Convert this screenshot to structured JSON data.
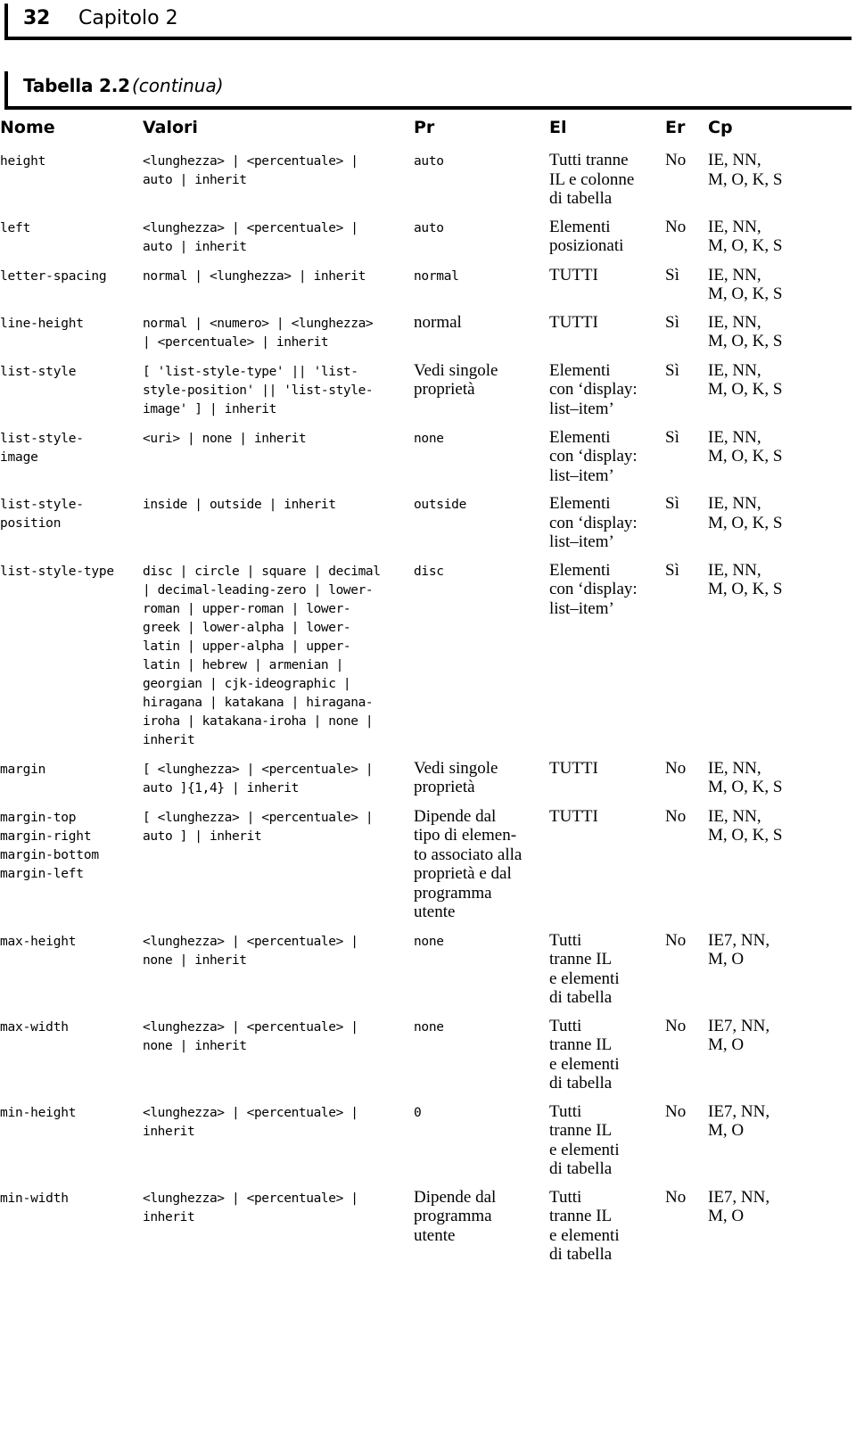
{
  "page": {
    "folio": "32",
    "chapter": "Capitolo 2"
  },
  "caption": {
    "label": "Tabella 2.2",
    "continued": "(continua)"
  },
  "table": {
    "columns": [
      "Nome",
      "Valori",
      "Pr",
      "El",
      "Er",
      "Cp"
    ],
    "rows": [
      {
        "name": "height",
        "values": "<lunghezza> | <percentuale> |\nauto | inherit",
        "pr": "auto",
        "pr_style": "mono",
        "el": "Tutti tranne\nIL e colonne\ndi tabella",
        "er": "No",
        "cp": "IE, NN,\nM, O, K, S"
      },
      {
        "name": "left",
        "values": "<lunghezza> | <percentuale> |\nauto | inherit",
        "pr": "auto",
        "pr_style": "mono",
        "el": "Elementi\nposizionati",
        "er": "No",
        "cp": "IE, NN,\nM, O, K, S"
      },
      {
        "name": "letter-spacing",
        "values": "normal | <lunghezza> | inherit",
        "pr": "normal",
        "pr_style": "mono",
        "el": "TUTTI",
        "er": "Sì",
        "cp": "IE, NN,\nM, O, K, S"
      },
      {
        "name": "line-height",
        "values": "normal | <numero> | <lunghezza>\n| <percentuale> | inherit",
        "pr": "normal",
        "pr_style": "serif",
        "el": "TUTTI",
        "er": "Sì",
        "cp": "IE, NN,\nM, O, K, S"
      },
      {
        "name": "list-style",
        "values": "[ 'list-style-type' || 'list-\nstyle-position' || 'list-style-\nimage' ] | inherit",
        "pr": "Vedi singole\nproprietà",
        "pr_style": "serif",
        "el": "Elementi\ncon ‘display:\nlist–item’",
        "er": "Sì",
        "cp": "IE, NN,\nM, O, K, S"
      },
      {
        "name": "list-style-\nimage",
        "values": "<uri> | none | inherit",
        "pr": "none",
        "pr_style": "mono",
        "el": "Elementi\ncon ‘display:\nlist–item’",
        "er": "Sì",
        "cp": "IE, NN,\nM, O, K, S"
      },
      {
        "name": "list-style-\nposition",
        "values": "inside | outside | inherit",
        "pr": "outside",
        "pr_style": "mono",
        "el": "Elementi\ncon ‘display:\nlist–item’",
        "er": "Sì",
        "cp": "IE, NN,\nM, O, K, S"
      },
      {
        "name": "list-style-type",
        "values": "disc | circle | square | decimal\n| decimal-leading-zero | lower-\nroman | upper-roman | lower-\ngreek | lower-alpha | lower-\nlatin | upper-alpha | upper-\nlatin | hebrew | armenian |\ngeorgian | cjk-ideographic |\nhiragana | katakana | hiragana-\niroha | katakana-iroha | none |\ninherit",
        "pr": "disc",
        "pr_style": "mono",
        "el": "Elementi\ncon ‘display:\nlist–item’",
        "er": "Sì",
        "cp": "IE, NN,\nM, O, K, S"
      },
      {
        "name": "margin",
        "values": "[ <lunghezza> | <percentuale> |\nauto ]{1,4} | inherit",
        "pr": "Vedi singole\nproprietà",
        "pr_style": "serif",
        "el": "TUTTI",
        "er": "No",
        "cp": "IE, NN,\nM, O, K, S"
      },
      {
        "name": "margin-top\nmargin-right\nmargin-bottom\nmargin-left",
        "values": "[ <lunghezza> | <percentuale> |\nauto ] | inherit",
        "pr": "Dipende dal\ntipo di elemen-\nto associato alla\nproprietà e dal\nprogramma\nutente",
        "pr_style": "serif",
        "el": "TUTTI",
        "er": "No",
        "cp": "IE, NN,\nM, O, K, S"
      },
      {
        "name": "max-height",
        "values": "<lunghezza> | <percentuale> |\nnone | inherit",
        "pr": "none",
        "pr_style": "mono",
        "el": "Tutti\ntranne IL\ne elementi\ndi tabella",
        "er": "No",
        "cp": "IE7, NN,\nM, O"
      },
      {
        "name": "max-width",
        "values": "<lunghezza> | <percentuale> |\nnone | inherit",
        "pr": "none",
        "pr_style": "mono",
        "el": "Tutti\ntranne IL\ne elementi\ndi tabella",
        "er": "No",
        "cp": "IE7, NN,\nM, O"
      },
      {
        "name": "min-height",
        "values": "<lunghezza> | <percentuale> |\ninherit",
        "pr": "0",
        "pr_style": "mono",
        "el": "Tutti\ntranne IL\ne elementi\ndi tabella",
        "er": "No",
        "cp": "IE7, NN,\nM, O"
      },
      {
        "name": "min-width",
        "values": "<lunghezza> | <percentuale> |\ninherit",
        "pr": "Dipende dal\nprogramma\nutente",
        "pr_style": "serif",
        "el": "Tutti\ntranne IL\ne elementi\ndi tabella",
        "er": "No",
        "cp": "IE7, NN,\nM, O"
      }
    ]
  }
}
